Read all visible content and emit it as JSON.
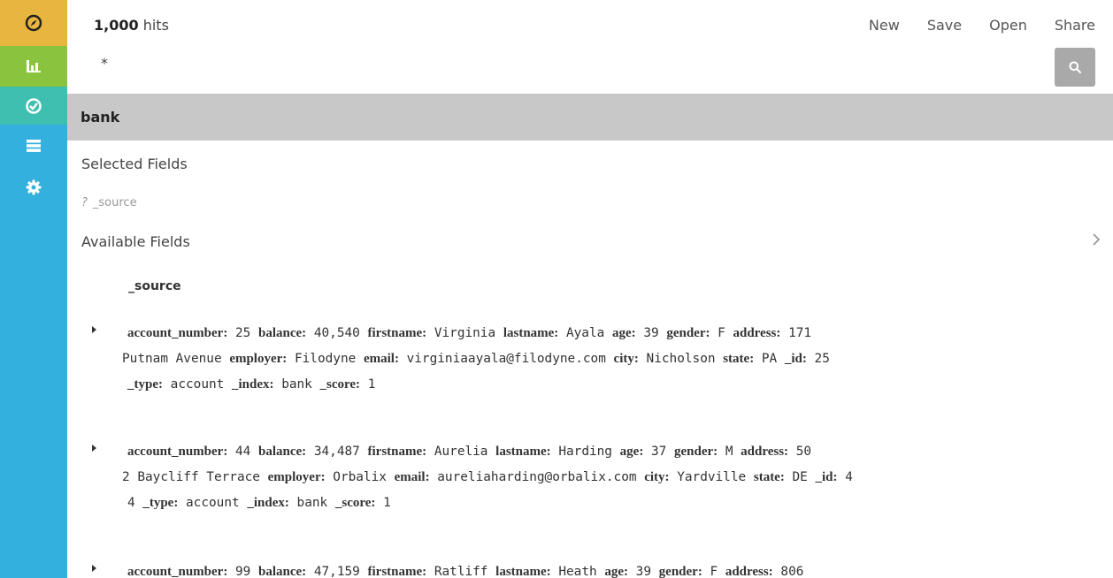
{
  "sidebar": {
    "items": [
      {
        "name": "discover",
        "icon": "compass-icon"
      },
      {
        "name": "visualize",
        "icon": "bar-chart-icon"
      },
      {
        "name": "dashboard",
        "icon": "dashboard-icon"
      },
      {
        "name": "list",
        "icon": "list-icon"
      },
      {
        "name": "settings",
        "icon": "gear-icon"
      }
    ],
    "colors": {
      "discover": "#e8b63f",
      "visualize": "#8ac33e",
      "dashboard": "#3fbfb0",
      "base": "#33b0dd"
    }
  },
  "header": {
    "hits_count": "1,000",
    "hits_label": "hits",
    "query": "*",
    "menu": [
      "New",
      "Save",
      "Open",
      "Share"
    ]
  },
  "index": {
    "name": "bank"
  },
  "fields": {
    "selected_title": "Selected Fields",
    "selected_field_type": "?",
    "selected_field": "_source",
    "available_title": "Available Fields"
  },
  "table": {
    "column_header": "_source",
    "docs": [
      {
        "lines": [
          [
            [
              "account_number:",
              "25"
            ],
            [
              "balance:",
              "40,540"
            ],
            [
              "firstname:",
              "Virginia"
            ],
            [
              "lastname:",
              "Ayala"
            ],
            [
              "age:",
              "39"
            ],
            [
              "gender:",
              "F"
            ],
            [
              "address:",
              "171"
            ]
          ],
          [
            [
              "",
              "Putnam Avenue"
            ],
            [
              "employer:",
              "Filodyne"
            ],
            [
              "email:",
              "virginiaayala@filodyne.com"
            ],
            [
              "city:",
              "Nicholson"
            ],
            [
              "state:",
              "PA"
            ],
            [
              "_id:",
              "25"
            ]
          ],
          [
            [
              "_type:",
              "account"
            ],
            [
              "_index:",
              "bank"
            ],
            [
              "_score:",
              "1"
            ]
          ]
        ]
      },
      {
        "lines": [
          [
            [
              "account_number:",
              "44"
            ],
            [
              "balance:",
              "34,487"
            ],
            [
              "firstname:",
              "Aurelia"
            ],
            [
              "lastname:",
              "Harding"
            ],
            [
              "age:",
              "37"
            ],
            [
              "gender:",
              "M"
            ],
            [
              "address:",
              "50"
            ]
          ],
          [
            [
              "",
              "2 Baycliff Terrace"
            ],
            [
              "employer:",
              "Orbalix"
            ],
            [
              "email:",
              "aureliaharding@orbalix.com"
            ],
            [
              "city:",
              "Yardville"
            ],
            [
              "state:",
              "DE"
            ],
            [
              "_id:",
              "4"
            ]
          ],
          [
            [
              "",
              "4"
            ],
            [
              "_type:",
              "account"
            ],
            [
              "_index:",
              "bank"
            ],
            [
              "_score:",
              "1"
            ]
          ]
        ]
      },
      {
        "lines": [
          [
            [
              "account_number:",
              "99"
            ],
            [
              "balance:",
              "47,159"
            ],
            [
              "firstname:",
              "Ratliff"
            ],
            [
              "lastname:",
              "Heath"
            ],
            [
              "age:",
              "39"
            ],
            [
              "gender:",
              "F"
            ],
            [
              "address:",
              "806"
            ]
          ]
        ]
      }
    ]
  }
}
